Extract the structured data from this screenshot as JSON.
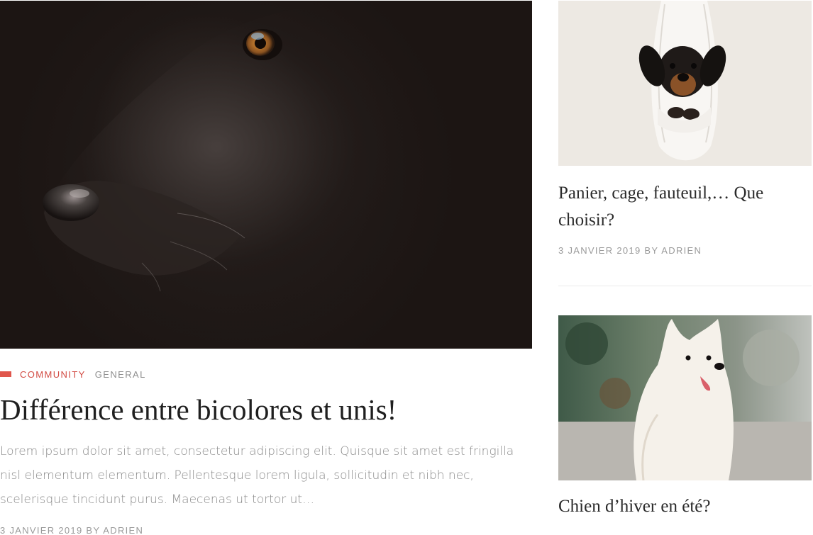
{
  "main_article": {
    "categories": [
      {
        "label": "COMMUNITY",
        "color": "#d24b43"
      },
      {
        "label": "GENERAL",
        "color": "#8f8f8f"
      }
    ],
    "title": "Différence entre bicolores et unis!",
    "excerpt": "Lorem ipsum dolor sit amet, consectetur adipiscing elit. Quisque sit amet est fringilla nisl elementum elementum. Pellentesque lorem ligula, sollicitudin et nibh nec, scelerisque tincidunt purus. Maecenas ut tortor ut…",
    "meta": "3 JANVIER 2019 BY ADRIEN"
  },
  "sidebar": {
    "posts": [
      {
        "title": "Panier, cage, fauteuil,… Que choisir?",
        "meta": "3 JANVIER 2019 BY ADRIEN"
      },
      {
        "title": "Chien d’hiver en été?"
      }
    ]
  },
  "colors": {
    "accent": "#e0564c",
    "category_active": "#d24b43",
    "text_dark": "#1f1f1f",
    "text_muted": "#8a8a8a"
  }
}
